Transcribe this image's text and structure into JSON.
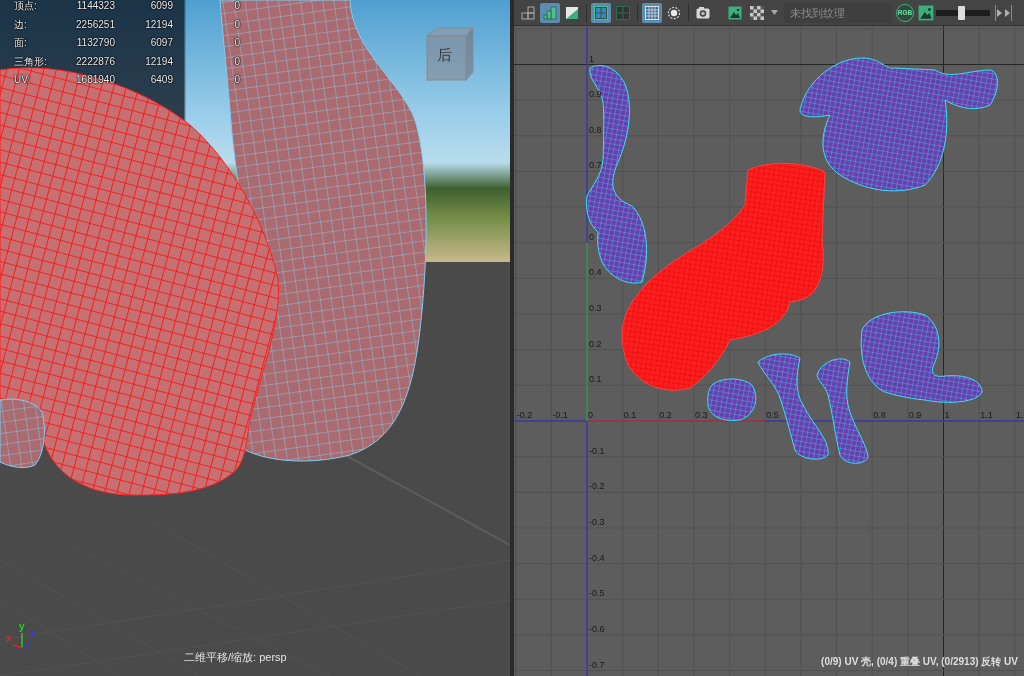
{
  "viewport": {
    "stats": [
      {
        "label": "顶点:",
        "values": [
          "1144323",
          "6099",
          "0"
        ]
      },
      {
        "label": "边:",
        "values": [
          "2256251",
          "12194",
          "0"
        ]
      },
      {
        "label": "面:",
        "values": [
          "1132790",
          "6097",
          "0"
        ]
      },
      {
        "label": "三角形:",
        "values": [
          "2222876",
          "12194",
          "0"
        ]
      },
      {
        "label": "UV:",
        "values": [
          "1681940",
          "6409",
          "0"
        ]
      }
    ],
    "meshes": [
      {
        "selected": false
      },
      {
        "selected": true
      },
      {
        "selected": false
      }
    ],
    "view_cube": {
      "face_label": "后"
    },
    "axis_gizmo": [
      {
        "label": "x",
        "color": "#e8202a"
      },
      {
        "label": "y",
        "color": "#2ccf2c"
      },
      {
        "label": "z",
        "color": "#3a3af0"
      }
    ],
    "camera_label": "二维平移/缩放: persp"
  },
  "uv_editor": {
    "toolbar": [
      {
        "selected": false
      },
      {
        "selected": true
      },
      {
        "selected": false
      },
      {
        "selected": true
      },
      {
        "selected": false
      },
      {
        "selected": true
      },
      {
        "selected": false
      },
      {
        "selected": false
      },
      {
        "selected": false
      },
      {
        "selected": false
      }
    ],
    "texture_field": {
      "value": "未找到纹理"
    },
    "rgb_button": "RGB",
    "exposure_slider": {
      "level": 0.46
    },
    "u_labels": [
      "-0.2",
      "-0.1",
      "0",
      "0.1",
      "0.2",
      "0.3",
      "0.5",
      "0.8",
      "0.9",
      "1",
      "1.1",
      "1."
    ],
    "v_labels": [
      "1",
      "0.9",
      "0.8",
      "0.7",
      "0",
      "0.4",
      "0.3",
      "0.2",
      "0.1",
      "-0.1",
      "-0.2",
      "-0.3",
      "-0.4",
      "-0.5",
      "-0.6",
      "-0.7"
    ],
    "shells": [
      {
        "selected": false
      },
      {
        "selected": false
      },
      {
        "selected": true
      },
      {
        "selected": false
      },
      {
        "selected": false
      },
      {
        "selected": false
      },
      {
        "selected": false
      }
    ],
    "status_text": "(0/9) UV 壳, (0/4) 重叠 UV, (0/2913) 反转 UV"
  }
}
